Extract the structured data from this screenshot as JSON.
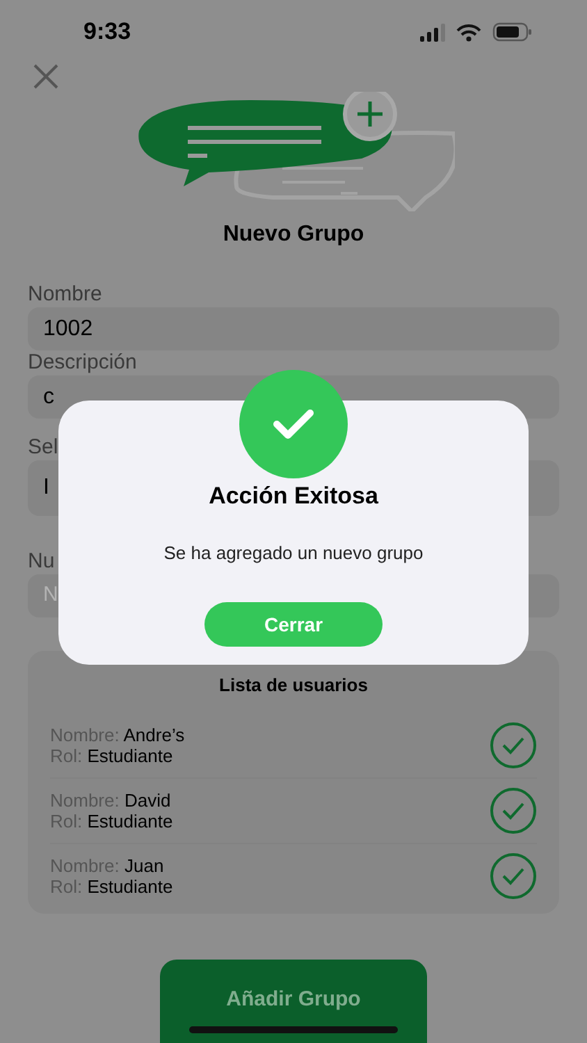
{
  "status_bar": {
    "time": "9:33"
  },
  "header": {
    "title": "Nuevo Grupo"
  },
  "form": {
    "fields": [
      {
        "label": "Nombre",
        "value": "1002",
        "kind": "text"
      },
      {
        "label": "Descripción",
        "value": "c",
        "kind": "text"
      },
      {
        "label": "Sel",
        "value": "I",
        "kind": "select"
      },
      {
        "label": "Nu",
        "placeholder": "N",
        "kind": "text"
      }
    ]
  },
  "user_list": {
    "title": "Lista de usuarios",
    "users": [
      {
        "name_label": "Nombre:",
        "name": "Andre’s",
        "role_label": "Rol:",
        "role": "Estudiante",
        "checked": true
      },
      {
        "name_label": "Nombre:",
        "name": "David",
        "role_label": "Rol:",
        "role": "Estudiante",
        "checked": true
      },
      {
        "name_label": "Nombre:",
        "name": "Juan",
        "role_label": "Rol:",
        "role": "Estudiante",
        "checked": true
      }
    ]
  },
  "add_button": {
    "label": "Añadir Grupo"
  },
  "dialog": {
    "title": "Acción Exitosa",
    "message": "Se ha agregado un nuevo grupo",
    "button": "Cerrar"
  }
}
